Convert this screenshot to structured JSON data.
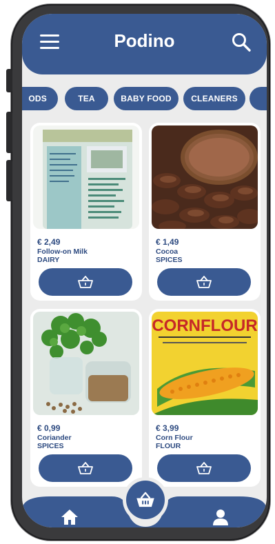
{
  "app": {
    "title": "Podino"
  },
  "header": {
    "menu_icon": "hamburger-icon",
    "search_icon": "search-icon"
  },
  "categories": [
    {
      "label": "ODS"
    },
    {
      "label": "TEA"
    },
    {
      "label": "BABY FOOD"
    },
    {
      "label": "CLEANERS"
    }
  ],
  "products": [
    {
      "price": "€ 2,49",
      "name": "Follow-on Milk",
      "category": "DAIRY"
    },
    {
      "price": "€ 1,49",
      "name": "Cocoa",
      "category": "SPICES"
    },
    {
      "price": "€ 0,99",
      "name": "Coriander",
      "category": "SPICES"
    },
    {
      "price": "€ 3,99",
      "name": "Corn Flour",
      "category": "FLOUR",
      "image_text": "CORNFLOUR"
    }
  ],
  "bottom_nav": {
    "home_icon": "home-icon",
    "cart_icon": "basket-icon",
    "profile_icon": "user-icon"
  },
  "colors": {
    "primary": "#3a5a92",
    "background": "#ececec",
    "text": "#2d4a80"
  }
}
